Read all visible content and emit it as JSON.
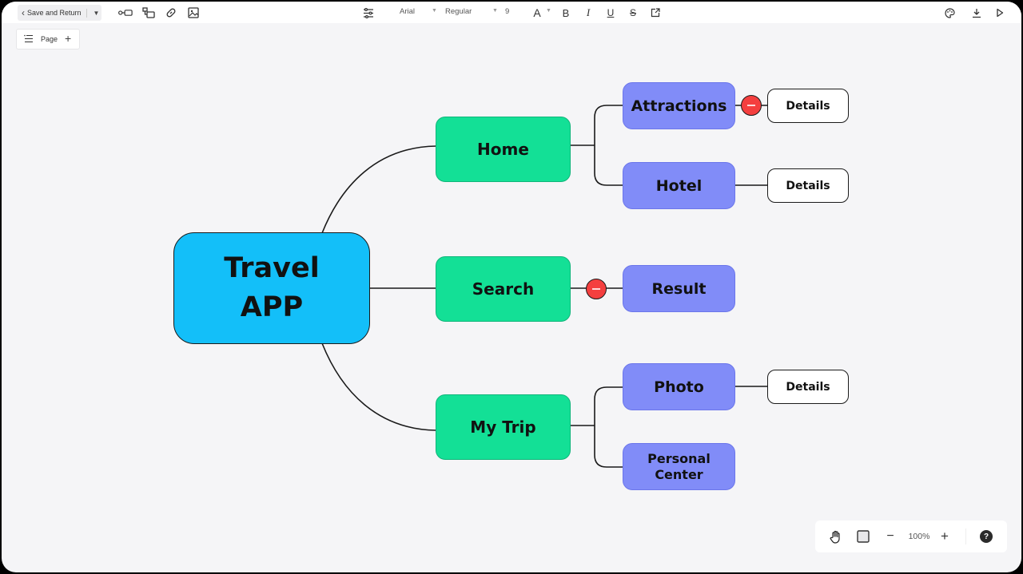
{
  "toolbar": {
    "save_return_label": "Save and Return",
    "font_family": "Arial",
    "font_weight": "Regular",
    "font_size": "9",
    "icons_left": [
      "connect-icon",
      "subtopic-icon",
      "link-icon",
      "image-icon"
    ],
    "icons_format": [
      "style-settings-icon",
      "font-color-icon",
      "bold-icon",
      "italic-icon",
      "underline-icon",
      "strikethrough-icon",
      "external-link-icon"
    ],
    "icons_right": [
      "theme-palette-icon",
      "download-icon",
      "play-icon"
    ],
    "bold_glyph": "B",
    "italic_glyph": "I",
    "underline_glyph": "U",
    "strike_glyph": "S",
    "font_color_glyph": "A"
  },
  "page_panel": {
    "label": "Page",
    "add_glyph": "+"
  },
  "mindmap": {
    "colors": {
      "root": "#13bff9",
      "level1": "#13e096",
      "level2": "#818cf8",
      "level3": "#ffffff",
      "collapse": "#f43f3f"
    },
    "root": {
      "label_line1": "Travel",
      "label_line2": "APP"
    },
    "branches": [
      {
        "label": "Home",
        "children": [
          {
            "label": "Attractions",
            "collapsed_toggle": true,
            "children": [
              {
                "label": "Details"
              }
            ]
          },
          {
            "label": "Hotel",
            "children": [
              {
                "label": "Details"
              }
            ]
          }
        ]
      },
      {
        "label": "Search",
        "collapsed_toggle": true,
        "children": [
          {
            "label": "Result"
          }
        ]
      },
      {
        "label": "My Trip",
        "children": [
          {
            "label": "Photo",
            "children": [
              {
                "label": "Details"
              }
            ]
          },
          {
            "label_line1": "Personal",
            "label_line2": "Center"
          }
        ]
      }
    ]
  },
  "zoom_controls": {
    "zoom_level": "100%",
    "minus": "−",
    "plus": "+",
    "help": "?"
  }
}
